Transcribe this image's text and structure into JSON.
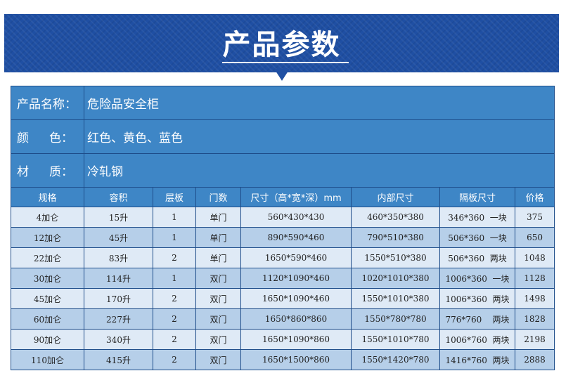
{
  "header": {
    "title": "产品参数"
  },
  "info": [
    {
      "label_chars": [
        "产品名称："
      ],
      "value": "危险品安全柜"
    },
    {
      "label_chars": [
        "颜",
        "色："
      ],
      "value": "红色、黄色、蓝色"
    },
    {
      "label_chars": [
        "材",
        "质："
      ],
      "value": "冷轧钢"
    }
  ],
  "table": {
    "columns": [
      "规格",
      "容积",
      "层板",
      "门数",
      "尺寸（高*宽*深）mm",
      "内部尺寸",
      "隔板尺寸",
      "价格"
    ],
    "rows": [
      [
        "4加仑",
        "15升",
        "1",
        "单门",
        "560*430*430",
        "460*350*380",
        "346*360  一块",
        "375"
      ],
      [
        "12加仑",
        "45升",
        "1",
        "单门",
        "890*590*460",
        "790*510*380",
        "506*360  一块",
        "650"
      ],
      [
        "22加仑",
        "83升",
        "2",
        "单门",
        "1650*590*460",
        "1550*510*380",
        "506*360  两块",
        "1048"
      ],
      [
        "30加仑",
        "114升",
        "1",
        "双门",
        "1120*1090*460",
        "1020*1010*380",
        "1006*360  一块",
        "1128"
      ],
      [
        "45加仑",
        "170升",
        "2",
        "双门",
        "1650*1090*460",
        "1550*1010*380",
        "1006*360  两块",
        "1498"
      ],
      [
        "60加仑",
        "227升",
        "2",
        "双门",
        "1650*860*860",
        "1550*780*780",
        "776*760    两块",
        "1828"
      ],
      [
        "90加仑",
        "340升",
        "2",
        "双门",
        "1650*1090*860",
        "1550*1010*780",
        "1006*760  两块",
        "2198"
      ],
      [
        "110加仑",
        "415升",
        "2",
        "双门",
        "1650*1500*860",
        "1550*1420*780",
        "1416*760  两块",
        "2888"
      ]
    ]
  },
  "colors": {
    "banner": "#1f4fa3",
    "header_cell": "#3e86c6",
    "row_light": "#dfeaf6",
    "row_dark": "#b6cfe9"
  }
}
